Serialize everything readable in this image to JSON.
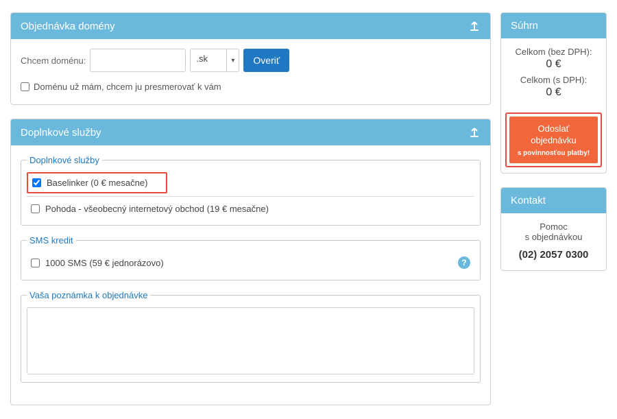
{
  "domain_panel": {
    "title": "Objednávka domény",
    "want_label": "Chcem doménu:",
    "domain_input": "",
    "tld_selected": ".sk",
    "verify_btn": "Overiť",
    "have_domain_label": "Doménu už mám, chcem ju presmerovať k vám"
  },
  "addons_panel": {
    "title": "Doplnkové služby",
    "services_legend": "Doplnkové služby",
    "baselinker_label": "Baselinker (0 € mesačne)",
    "pohoda_label": "Pohoda - všeobecný internetový obchod (19 € mesačne)",
    "sms_legend": "SMS kredit",
    "sms_label": "1000 SMS (59 € jednorázovo)",
    "note_legend": "Vaša poznámka k objednávke",
    "note_value": ""
  },
  "summary_panel": {
    "title": "Súhrn",
    "no_vat_label": "Celkom (bez DPH):",
    "no_vat_value": "0 €",
    "vat_label": "Celkom (s DPH):",
    "vat_value": "0 €",
    "submit_line1": "Odoslať",
    "submit_line2": "objednávku",
    "submit_sub": "s povinnosťou platby!"
  },
  "contact_panel": {
    "title": "Kontakt",
    "help_line1": "Pomoc",
    "help_line2": "s objednávkou",
    "phone": "(02) 2057 0300"
  }
}
